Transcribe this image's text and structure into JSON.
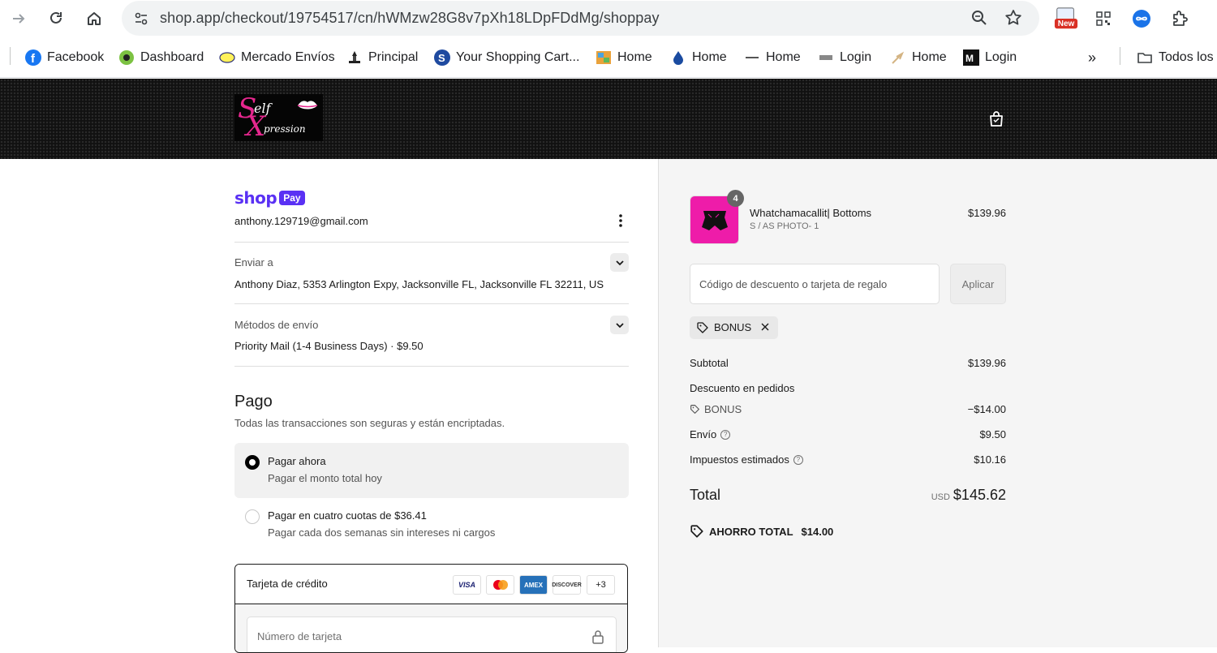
{
  "browser": {
    "url": "shop.app/checkout/19754517/cn/hWMzw28G8v7pXh18LDpFDdMg/shoppay",
    "new_badge": "New",
    "bookmarks": [
      {
        "label": "Facebook"
      },
      {
        "label": "Dashboard"
      },
      {
        "label": "Mercado Envíos"
      },
      {
        "label": "Principal"
      },
      {
        "label": "Your Shopping Cart..."
      },
      {
        "label": "Home"
      },
      {
        "label": "Home"
      },
      {
        "label": "Home"
      },
      {
        "label": "Login"
      },
      {
        "label": "Home"
      },
      {
        "label": "Login"
      }
    ],
    "overflow": "»",
    "all_bookmarks": "Todos los"
  },
  "store": {
    "logo_text": {
      "s": "S",
      "elf": "elf",
      "x": "X",
      "pression": "pression"
    }
  },
  "account": {
    "brand": "shop",
    "brand_pay": "Pay",
    "email": "anthony.129719@gmail.com"
  },
  "shipping": {
    "ship_to_label": "Enviar a",
    "ship_to_value": "Anthony Diaz, 5353 Arlington Expy, Jacksonville FL, Jacksonville FL 32211, US",
    "methods_label": "Métodos de envío",
    "methods_value": "Priority Mail (1-4 Business Days) · $9.50"
  },
  "payment": {
    "title": "Pago",
    "subtitle": "Todas las transacciones son seguras y están encriptadas.",
    "options": [
      {
        "title": "Pagar ahora",
        "desc": "Pagar el monto total hoy",
        "selected": true
      },
      {
        "title": "Pagar en cuatro cuotas de $36.41",
        "desc": "Pagar cada dos semanas sin intereses ni cargos",
        "selected": false
      }
    ],
    "card_method_label": "Tarjeta de crédito",
    "card_brands": [
      "VISA",
      "mastercard",
      "AMEX",
      "DISCOVER"
    ],
    "more_brands": "+3",
    "card_number_placeholder": "Número de tarjeta"
  },
  "summary": {
    "item": {
      "name": "Whatchamacallit| Bottoms",
      "variant": "S / AS PHOTO- 1",
      "price": "$139.96",
      "quantity": "4"
    },
    "discount_placeholder": "Código de descuento o tarjeta de regalo",
    "apply_label": "Aplicar",
    "applied_code": "BONUS",
    "subtotal_label": "Subtotal",
    "subtotal_value": "$139.96",
    "order_discount_label": "Descuento en pedidos",
    "order_discount_code": "BONUS",
    "order_discount_value": "−$14.00",
    "shipping_label": "Envío",
    "shipping_value": "$9.50",
    "tax_label": "Impuestos estimados",
    "tax_value": "$10.16",
    "total_label": "Total",
    "total_currency": "USD",
    "total_value": "$145.62",
    "savings_label": "AHORRO TOTAL",
    "savings_value": "$14.00"
  },
  "colors": {
    "shop_purple": "#5a31f4",
    "brand_pink": "#ee1ca9"
  }
}
